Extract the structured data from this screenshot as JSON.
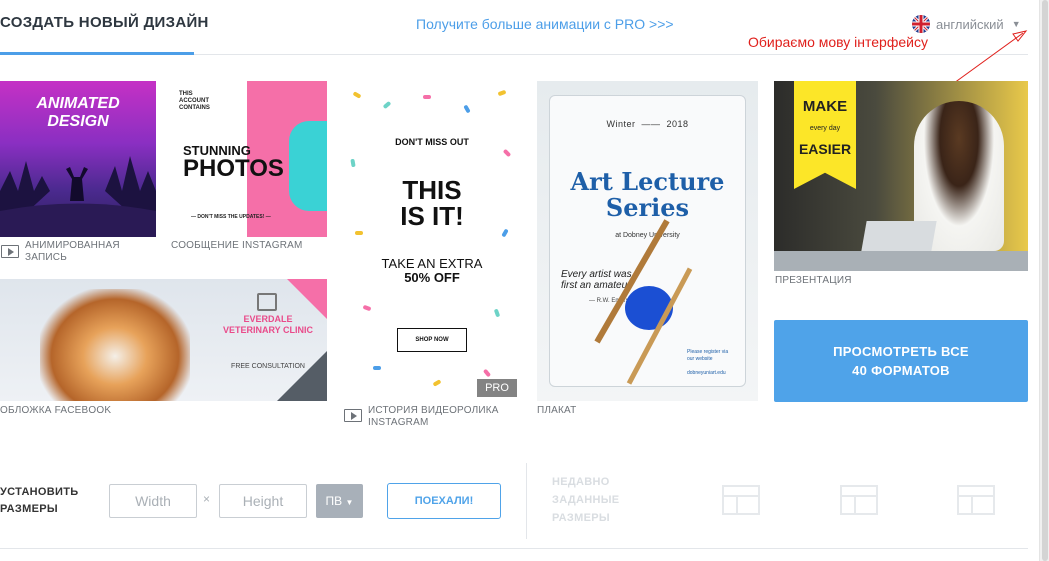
{
  "header": {
    "create_tab": "СОЗДАТЬ НОВЫЙ ДИЗАЙН",
    "pro_link": "Получите больше анимации с PRO >>>",
    "language": "английский",
    "annotation": "Обираємо мову інтерфейсу"
  },
  "templates": [
    {
      "caption": "АНИМИРОВАННАЯ ЗАПИСЬ",
      "caption_line1": "АНИМИРОВАННАЯ",
      "caption_line2": "ЗАПИСЬ",
      "artwork_text": "ANIMATED DESIGN",
      "artwork_line1": "ANIMATED",
      "artwork_line2": "DESIGN",
      "video": true
    },
    {
      "caption": "СООБЩЕНИЕ INSTAGRAM",
      "artwork_small": "THIS ACCOUNT CONTAINS",
      "artwork_small1": "THIS",
      "artwork_small2": "ACCOUNT",
      "artwork_small3": "CONTAINS",
      "artwork_line1": "STUNNING",
      "artwork_line2": "PHOTOS",
      "artwork_foot": "— DON'T MISS THE UPDATES! —"
    },
    {
      "caption": "ОБЛОЖКА FACEBOOK",
      "artwork_clinic": "EVERDALE VETERINARY CLINIC",
      "artwork_clinic1": "EVERDALE",
      "artwork_clinic2": "VETERINARY CLINIC",
      "artwork_consult": "FREE CONSULTATION"
    },
    {
      "caption": "ИСТОРИЯ ВИДЕОРОЛИКА INSTAGRAM",
      "caption_line1": "ИСТОРИЯ ВИДЕОРОЛИКА",
      "caption_line2": "INSTAGRAM",
      "artwork_miss": "DON'T MISS OUT",
      "artwork_line1": "THIS",
      "artwork_line2": "IS IT!",
      "artwork_extra1": "TAKE AN EXTRA",
      "artwork_extra2": "50% OFF",
      "artwork_shop": "SHOP NOW",
      "badge": "PRO",
      "video": true
    },
    {
      "caption": "ПЛАКАТ",
      "artwork_season": "Winter",
      "artwork_year": "2018",
      "artwork_title1": "Art Lecture",
      "artwork_title2": "Series",
      "artwork_univ": "at Dobney University",
      "artwork_quote1": "Every artist was",
      "artwork_quote2": "first an amateur",
      "artwork_author": "— R.W. Emerson",
      "artwork_site1": "Please register via",
      "artwork_site2": "our website",
      "artwork_site3": "dobneyuniart.edu"
    },
    {
      "caption": "ПРЕЗЕНТАЦИЯ",
      "artwork_make": "MAKE",
      "artwork_every": "every day",
      "artwork_easier": "EASIER"
    }
  ],
  "view_all": {
    "line1": "ПРОСМОТРЕТЬ ВСЕ",
    "line2": "40 ФОРМАТОВ"
  },
  "custom_size": {
    "label_line1": "УСТАНОВИТЬ",
    "label_line2": "РАЗМЕРЫ",
    "width_placeholder": "Width",
    "height_placeholder": "Height",
    "separator": "×",
    "unit": "ПВ",
    "go_button": "ПОЕХАЛИ!"
  },
  "recent_sizes": {
    "line1": "НЕДАВНО",
    "line2": "ЗАДАННЫЕ",
    "line3": "РАЗМЕРЫ"
  },
  "colors": {
    "accent": "#4c9ee8",
    "annotation": "#e0201c",
    "pink": "#f56fa8",
    "yellow": "#fce628"
  }
}
